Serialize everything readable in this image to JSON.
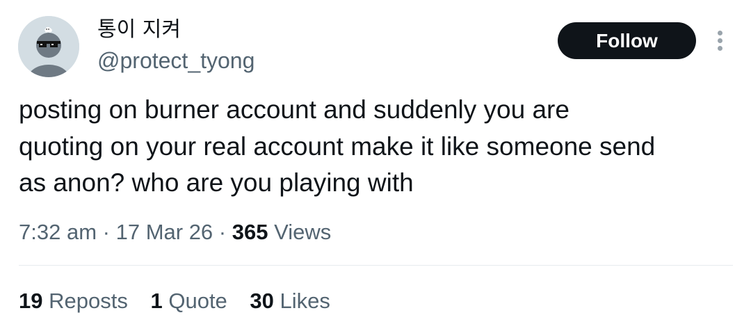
{
  "author": {
    "display_name": "통이 지켜",
    "handle": "@protect_tyong",
    "avatar_icon": "avatar-with-sunglasses-icon"
  },
  "follow_button": {
    "label": "Follow"
  },
  "more_menu": {
    "icon": "more-vertical-icon"
  },
  "tweet": {
    "text": "posting on burner account and suddenly you are\nquoting on your real account make it like someone send\nas anon? who are you playing with"
  },
  "meta": {
    "time": "7:32 am",
    "separator": "·",
    "date": "17 Mar 26",
    "views_count": "365",
    "views_label": "Views"
  },
  "stats": {
    "reposts_count": "19",
    "reposts_label": "Reposts",
    "quotes_count": "1",
    "quotes_label": "Quote",
    "likes_count": "30",
    "likes_label": "Likes"
  },
  "colors": {
    "text_primary": "#0f1419",
    "text_secondary": "#536471",
    "follow_bg": "#0f1419",
    "follow_text": "#ffffff",
    "divider": "#e6ebee"
  }
}
